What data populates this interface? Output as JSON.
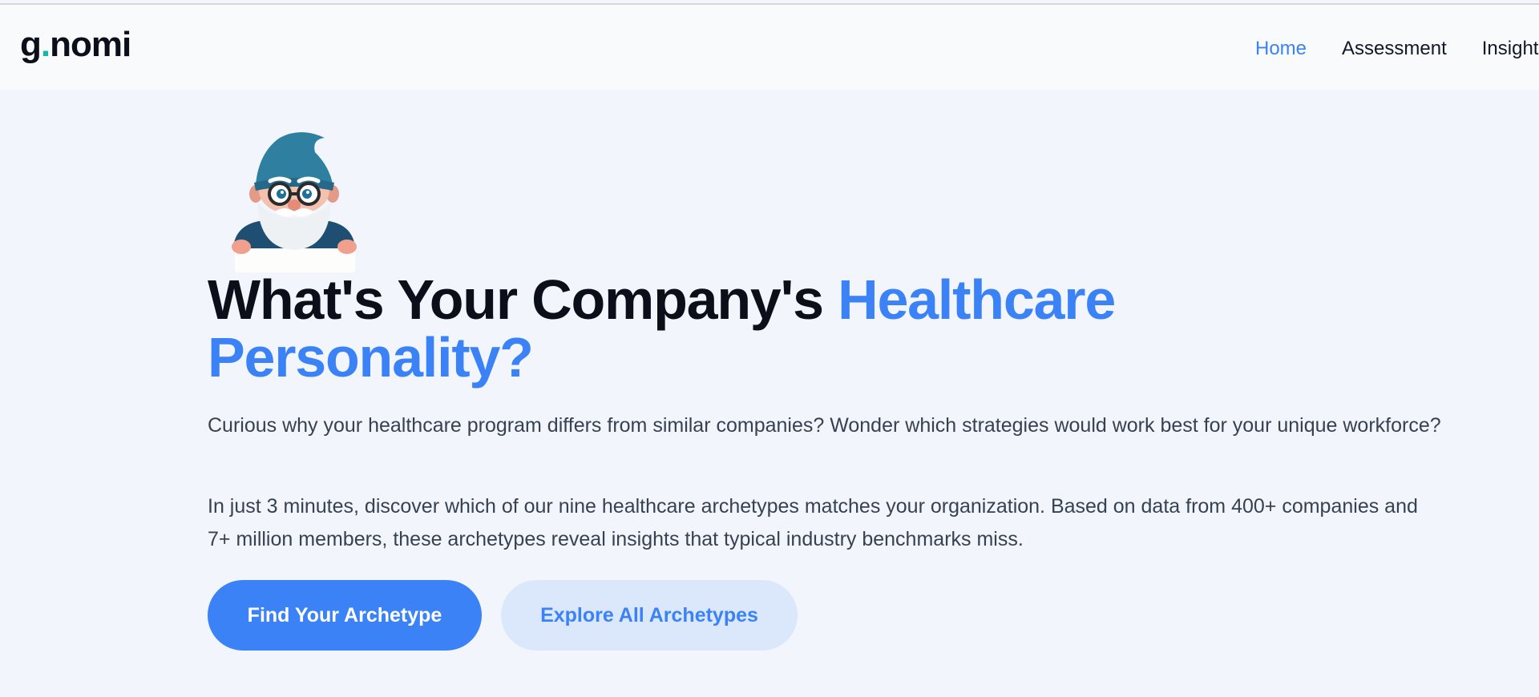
{
  "header": {
    "logo_g": "g",
    "logo_dot": ".",
    "logo_rest": "nomi",
    "nav": [
      {
        "label": "Home",
        "active": true
      },
      {
        "label": "Assessment",
        "active": false
      },
      {
        "label": "Insights",
        "active": false
      }
    ]
  },
  "hero": {
    "title_part1": "What's Your Company's ",
    "title_accent": "Healthcare Personality?",
    "paragraph1": "Curious why your healthcare program differs from similar companies? Wonder which strategies would work best for your unique workforce?",
    "paragraph2": "In just 3 minutes, discover which of our nine healthcare archetypes matches your organization. Based on data from 400+ companies and 7+ million members, these archetypes reveal insights that typical industry benchmarks miss.",
    "primary_button": "Find Your Archetype",
    "secondary_button": "Explore All Archetypes",
    "illustration": "gnome-mascot-icon"
  },
  "colors": {
    "accent": "#3b82f6",
    "logo_dot": "#14b8a6",
    "background": "#f2f6fc",
    "header_bg": "#f8fafc",
    "secondary_button_bg": "#dbe8fc"
  }
}
